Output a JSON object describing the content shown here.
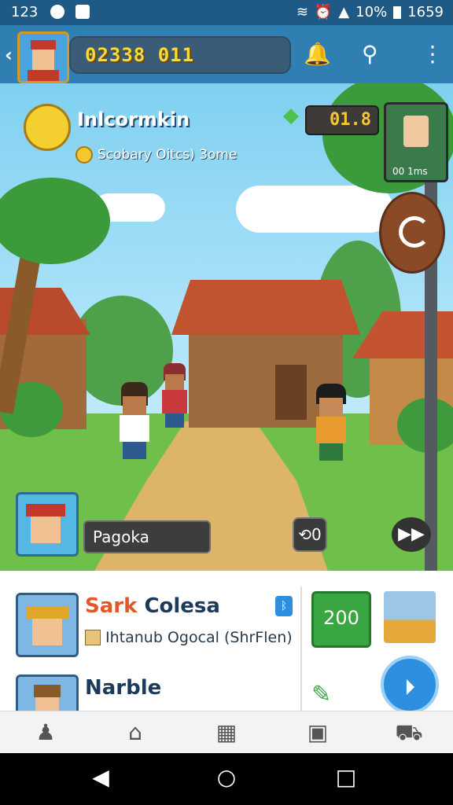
{
  "status_bar": {
    "time": "123",
    "battery": "10%",
    "clock": "1659"
  },
  "header": {
    "score": "02338 011"
  },
  "hud": {
    "title": "Inlcormkin",
    "subtitle": "Scobary Oitcs) 3ome",
    "timer": "01.8",
    "npc_label": "00 1ms"
  },
  "scene": {
    "player_name": "Pagoka",
    "action_button": "⟲0",
    "fast_forward_button": "▶▶"
  },
  "panel": {
    "card1": {
      "title_part1": "Sark",
      "title_part2": " Colesa",
      "subtitle": "Ihtanub Ogocal (ShrFlen)"
    },
    "score_button": "200",
    "card2": {
      "title": "Narble"
    }
  },
  "icons": {
    "status": [
      "app-icon",
      "image-icon",
      "wifi-icon",
      "alarm-icon",
      "signal-icon",
      "battery-icon"
    ],
    "header": [
      "back-icon",
      "bell-icon",
      "search-icon",
      "more-icon"
    ],
    "bottom_nav": [
      "profile-icon",
      "home-icon",
      "shop-icon",
      "device-icon",
      "cart-icon"
    ],
    "system_nav": [
      "back-triangle-icon",
      "home-circle-icon",
      "recents-square-icon"
    ]
  }
}
